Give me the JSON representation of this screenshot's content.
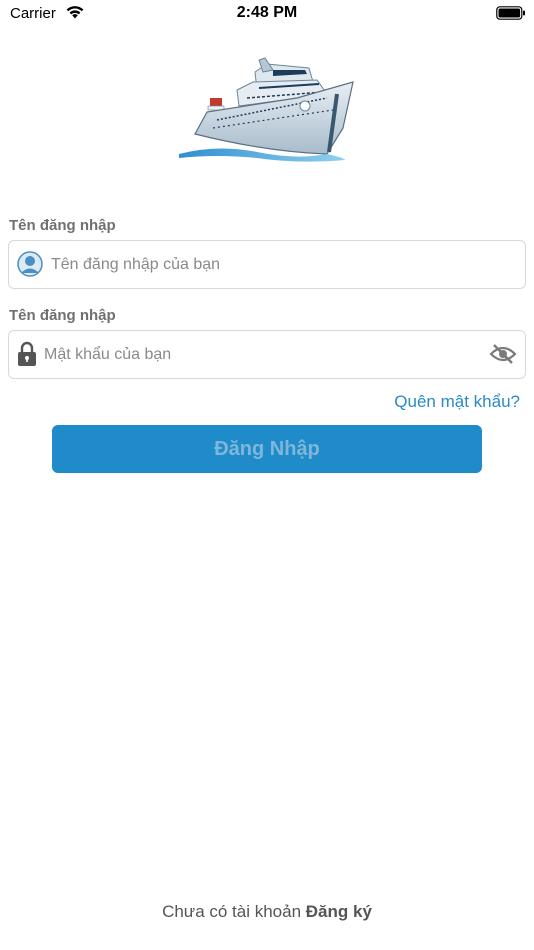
{
  "status_bar": {
    "carrier": "Carrier",
    "time": "2:48 PM",
    "wifi_icon": "wifi-icon",
    "battery_icon": "battery-icon"
  },
  "logo": {
    "icon": "cruise-ship-logo"
  },
  "username": {
    "label": "Tên đăng nhập",
    "placeholder": "Tên đăng nhập của bạn",
    "value": "",
    "icon": "user-icon"
  },
  "password": {
    "label": "Tên đăng nhập",
    "placeholder": "Mật khẩu của bạn",
    "value": "",
    "icon": "lock-icon",
    "toggle_icon": "eye-off-icon"
  },
  "forgot_password": "Quên mật khẩu?",
  "login_button": "Đăng Nhập",
  "footer": {
    "prompt": "Chưa có tài khoản",
    "register": "Đăng ký"
  },
  "colors": {
    "accent": "#1f8bc8",
    "link": "#2a8ac4",
    "label": "#707070"
  }
}
